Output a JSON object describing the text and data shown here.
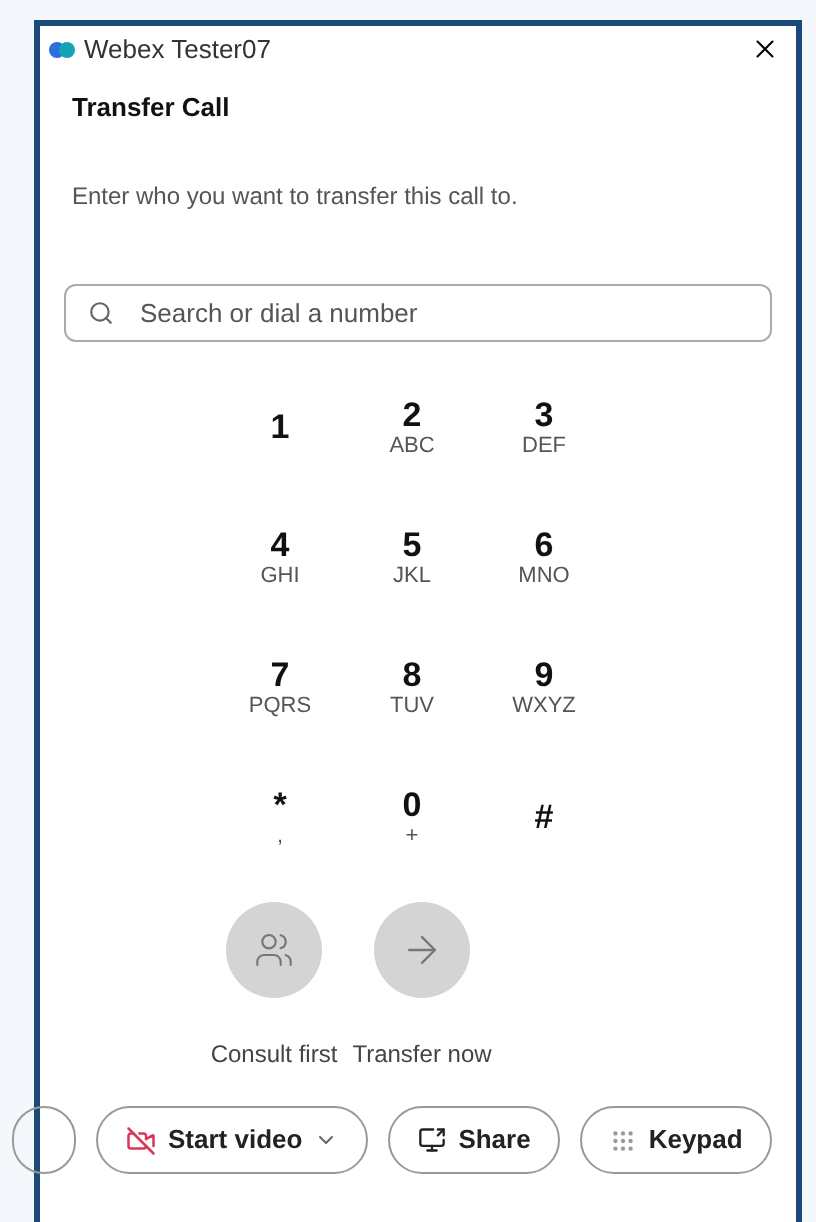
{
  "window": {
    "title": "Webex Tester07"
  },
  "heading": "Transfer Call",
  "instruction": "Enter who you want to transfer this call to.",
  "search": {
    "placeholder": "Search or dial a number"
  },
  "keypad": [
    {
      "digit": "1"
    },
    {
      "digit": "2",
      "letters": "ABC"
    },
    {
      "digit": "3",
      "letters": "DEF"
    },
    {
      "digit": "4",
      "letters": "GHI"
    },
    {
      "digit": "5",
      "letters": "JKL"
    },
    {
      "digit": "6",
      "letters": "MNO"
    },
    {
      "digit": "7",
      "letters": "PQRS"
    },
    {
      "digit": "8",
      "letters": "TUV"
    },
    {
      "digit": "9",
      "letters": "WXYZ"
    },
    {
      "digit": "*",
      "letters": ","
    },
    {
      "digit": "0",
      "letters": "+"
    },
    {
      "digit": "#"
    }
  ],
  "actions": [
    {
      "kind": "consult",
      "label": "Consult first",
      "disabled": true
    },
    {
      "kind": "transfer",
      "label": "Transfer now",
      "disabled": true
    }
  ],
  "toolbar": [
    {
      "kind": "video",
      "label": "Start video"
    },
    {
      "kind": "share",
      "label": "Share"
    },
    {
      "kind": "keypad",
      "label": "Keypad"
    }
  ]
}
